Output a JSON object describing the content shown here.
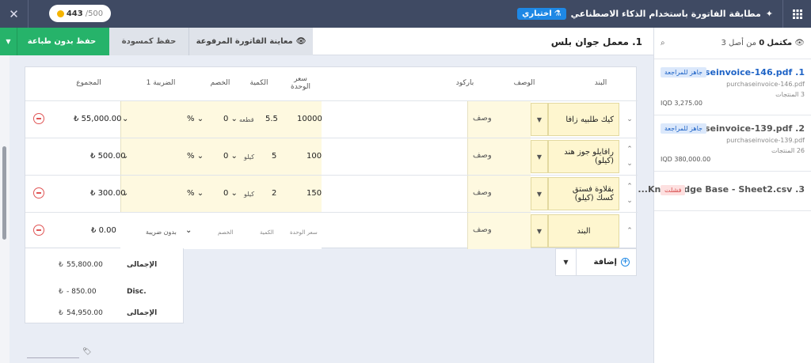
{
  "topbar": {
    "title": "مطابقة الفاتورة باستخدام الذكاء الاصطناعي",
    "beta_label": "اختباري",
    "credits_used": "443",
    "credits_total": "/500",
    "colors": {
      "bar": "#3f4a63",
      "beta": "#1e88e5",
      "coin": "#f5b400"
    }
  },
  "actions": {
    "save_no_print": "حفظ بدون طباعة",
    "save_draft": "حفظ كمسودة",
    "preview": "معاينة الفاتورة المرفوعة",
    "document_title": "1. معمل جوان بلس",
    "colors": {
      "save": "#26b36a"
    }
  },
  "table": {
    "headers": {
      "item": "البند",
      "description": "الوصف",
      "barcode": "باركود",
      "unit_price": "سعر الوحدة",
      "quantity": "الكمية",
      "discount": "الخصم",
      "tax": "الضريبة 1",
      "total": "المجموع"
    },
    "rows": [
      {
        "item": "كيك طلبيه زافا",
        "description": "وصف",
        "unit_price": "10000",
        "quantity": "5.5",
        "unit": "قطعه",
        "discount": "0",
        "discount_type": "%",
        "total": "55,000.00"
      },
      {
        "item": "رافايلو جوز هند (كيلو)",
        "description": "وصف",
        "unit_price": "100",
        "quantity": "5",
        "unit": "كيلو",
        "discount": "0",
        "discount_type": "%",
        "total": "500.00"
      },
      {
        "item": "بقلاوة فستق كسك (كيلو)",
        "description": "وصف",
        "unit_price": "150",
        "quantity": "2",
        "unit": "كيلو",
        "discount": "0",
        "discount_type": "%",
        "total": "300.00"
      }
    ],
    "new_row": {
      "item_placeholder": "البند",
      "description": "وصف",
      "unit_price_placeholder": "سعر الوحدة",
      "quantity_placeholder": "الكمية",
      "discount_placeholder": "الخصم",
      "tax_placeholder": "بدون ضريبة",
      "total": "0.00"
    },
    "currency_symbol": "₺"
  },
  "add": {
    "label": "إضافة"
  },
  "totals": {
    "subtotal_label": "الإجمالى",
    "subtotal": "55,800.00",
    "discount_label": "Disc.",
    "discount": "- 850.00",
    "total_label": "الإجمالى",
    "total": "54,950.00"
  },
  "sidebar": {
    "completed_label": "مكتمل",
    "completed_count": "0",
    "of_label": "من أصل",
    "total_count": "3",
    "items": [
      {
        "name": "1. purchaseinvoice-146.pdf...",
        "file": "purchaseinvoice-146.pdf",
        "count": "3 المنتجات",
        "amount": "IQD 3,275.00",
        "status": "جاهز للمراجعة"
      },
      {
        "name": "2. purchaseinvoice-139.pdf...",
        "file": "purchaseinvoice-139.pdf",
        "count": "26 المنتجات",
        "amount": "IQD 380,000.00",
        "status": "جاهز للمراجعة"
      },
      {
        "name": "3. Knowledge Base - Sheet2.csv...",
        "status": "فشلت"
      }
    ]
  }
}
